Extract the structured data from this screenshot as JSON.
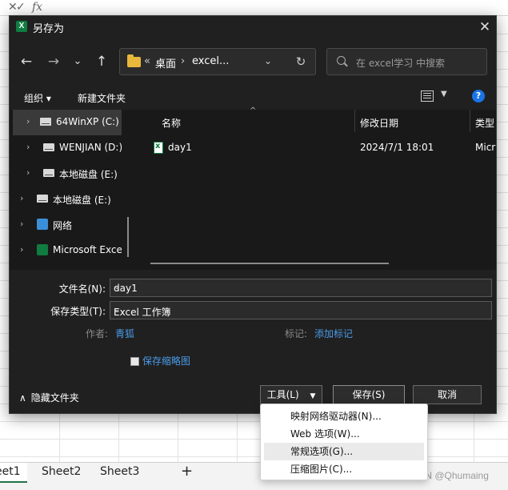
{
  "excel": {
    "formula_cancel": "✕",
    "formula_ok": "✓",
    "formula_fx": "fx",
    "sheets": [
      "eet1",
      "Sheet2",
      "Sheet3"
    ],
    "add_sheet": "+",
    "watermark": "CSDN @Qhumaing"
  },
  "dialog": {
    "app_icon": "X",
    "title": "另存为",
    "close": "✕"
  },
  "nav": {
    "back": "←",
    "forward": "→",
    "recent": "⌄",
    "up": "↑",
    "breadcrumb_prefix": "«",
    "crumb_1": "桌面",
    "crumb_sep": "›",
    "crumb_2": "excel...",
    "address_chevron": "⌄",
    "refresh": "↻",
    "search_placeholder": "在 excel学习 中搜索"
  },
  "toolbar": {
    "organize": "组织 ▾",
    "new_folder": "新建文件夹",
    "view_dropdown": "▼",
    "help": "?"
  },
  "nav_pane": {
    "items": [
      {
        "label": "64WinXP (C:)",
        "icon": "drive-icon"
      },
      {
        "label": "WENJIAN (D:)",
        "icon": "drive-icon"
      },
      {
        "label": "本地磁盘 (E:)",
        "icon": "drive-icon"
      },
      {
        "label": "本地磁盘 (E:)",
        "icon": "drive-icon"
      },
      {
        "label": "网络",
        "icon": "network-icon"
      },
      {
        "label": "Microsoft Excel",
        "icon": "excel-icon"
      }
    ],
    "expander": "›"
  },
  "file_list": {
    "columns": {
      "name": "名称",
      "date": "修改日期",
      "type": "类型"
    },
    "sort_indicator": "^",
    "rows": [
      {
        "name": "day1",
        "date": "2024/7/1 18:01",
        "type": "Micr"
      }
    ]
  },
  "form": {
    "filename_label": "文件名(N):",
    "filename_value": "day1",
    "filetype_label": "保存类型(T):",
    "filetype_value": "Excel 工作簿",
    "author_label": "作者:",
    "author_value": "青狐",
    "tags_label": "标记:",
    "tags_value": "添加标记",
    "thumbnail_label": "保存缩略图",
    "dropdown_glyph": "⌄"
  },
  "footer": {
    "hide_folders": "隐藏文件夹",
    "hide_glyph": "∧",
    "tools_label": "工具(L)",
    "tools_glyph": "▼",
    "save_label": "保存(S)",
    "cancel_label": "取消"
  },
  "tools_menu": {
    "items": [
      "映射网络驱动器(N)...",
      "Web 选项(W)...",
      "常规选项(G)...",
      "压缩图片(C)..."
    ]
  },
  "colors": {
    "dialog_bg": "#202020",
    "pane_bg": "#191919",
    "link": "#4a9be8",
    "excel_green": "#217346"
  }
}
